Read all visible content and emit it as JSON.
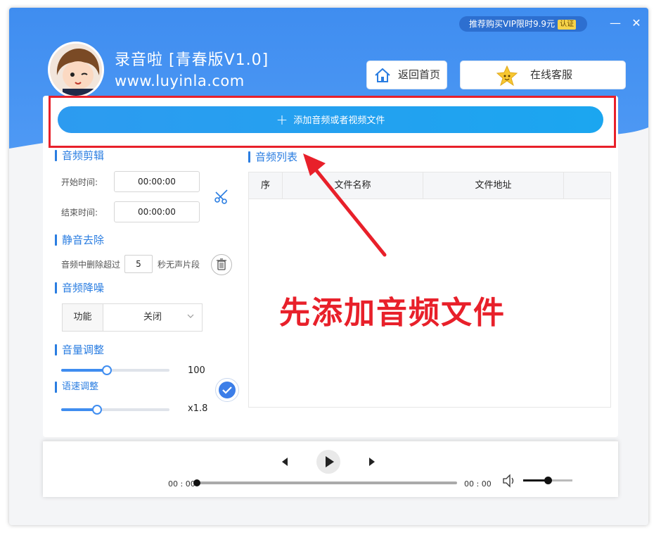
{
  "window": {
    "vip_text": "推荐购买VIP限时9.9元",
    "vip_tag": "认证",
    "minimize": "—",
    "close": "✕"
  },
  "app": {
    "title": "录音啦 [青春版V1.0]",
    "url": "www.luyinla.com"
  },
  "header": {
    "home_label": "返回首页",
    "service_label": "在线客服"
  },
  "toolbar": {
    "add_label": "添加音频或者视频文件"
  },
  "sections": {
    "clip": {
      "title": "音频剪辑",
      "start_label": "开始时间:",
      "start_value": "00:00:00",
      "end_label": "结束时间:",
      "end_value": "00:00:00"
    },
    "silence": {
      "title": "静音去除",
      "prefix": "音频中删除超过",
      "value": "5",
      "suffix": "秒无声片段"
    },
    "denoise": {
      "title": "音频降噪",
      "key": "功能",
      "value": "关闭"
    },
    "volume": {
      "title": "音量调整",
      "value": "100",
      "level": 0.42
    },
    "speed": {
      "title": "语速调整",
      "value": "x1.8",
      "level": 0.33
    }
  },
  "list": {
    "title": "音频列表",
    "columns": [
      "序",
      "文件名称",
      "文件地址"
    ]
  },
  "annotation": {
    "text": "先添加音频文件",
    "color": "#e8202a"
  },
  "player": {
    "current": "00 : 00",
    "total": "00 : 00",
    "progress": 0,
    "volume": 0.5
  },
  "colors": {
    "accent": "#3f8df0",
    "title_blue": "#2a7de1"
  }
}
